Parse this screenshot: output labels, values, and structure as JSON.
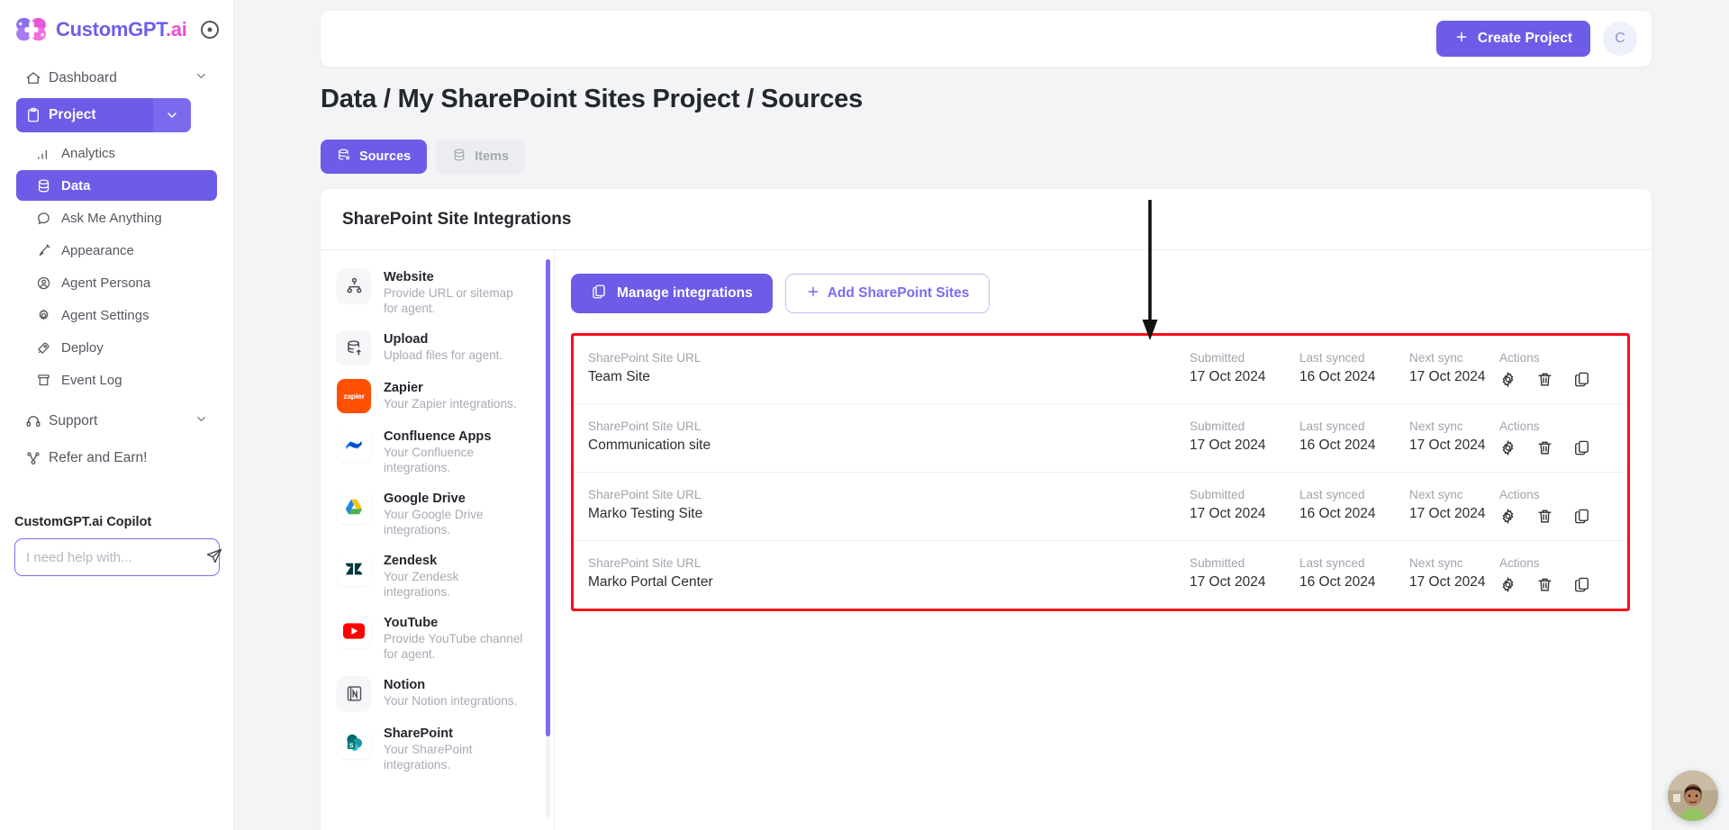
{
  "brand": {
    "name_part1": "CustomGPT",
    "name_part2": ".ai",
    "help_icon": "help-circle-icon"
  },
  "sidebar": {
    "nav": [
      {
        "label": "Dashboard",
        "icon": "home-icon",
        "chevron": "chevron-down-icon"
      },
      {
        "label": "Project",
        "icon": "clipboard-icon",
        "chevron": "chevron-down-icon"
      }
    ],
    "subnav": [
      {
        "label": "Analytics",
        "icon": "bar-chart-icon"
      },
      {
        "label": "Data",
        "icon": "database-icon"
      },
      {
        "label": "Ask Me Anything",
        "icon": "chat-bubble-icon"
      },
      {
        "label": "Appearance",
        "icon": "brush-icon"
      },
      {
        "label": "Agent Persona",
        "icon": "user-circle-icon"
      },
      {
        "label": "Agent Settings",
        "icon": "gear-icon"
      },
      {
        "label": "Deploy",
        "icon": "rocket-icon"
      },
      {
        "label": "Event Log",
        "icon": "archive-icon"
      }
    ],
    "support": {
      "label": "Support",
      "icon": "headset-icon",
      "chevron": "chevron-down-icon"
    },
    "refer": {
      "label": "Refer and Earn!",
      "icon": "share-nodes-icon"
    },
    "copilot": {
      "title": "CustomGPT.ai Copilot",
      "placeholder": "I need help with...",
      "value": "",
      "send_icon": "send-icon"
    }
  },
  "topbar": {
    "create_label": "Create Project",
    "plus_icon": "plus-icon",
    "avatar_initial": "C"
  },
  "page": {
    "title": "Data / My SharePoint Sites Project / Sources",
    "tabs": [
      {
        "label": "Sources",
        "icon": "database-gear-icon",
        "selected": true
      },
      {
        "label": "Items",
        "icon": "database-icon",
        "selected": false
      }
    ]
  },
  "card": {
    "heading": "SharePoint Site Integrations",
    "integrations": [
      {
        "name": "Website",
        "desc": "Provide URL or sitemap for agent.",
        "icon": "sitemap-icon"
      },
      {
        "name": "Upload",
        "desc": "Upload files for agent.",
        "icon": "database-upload-icon"
      },
      {
        "name": "Zapier",
        "desc": "Your Zapier integrations.",
        "icon": "zapier-icon"
      },
      {
        "name": "Confluence Apps",
        "desc": "Your Confluence integrations.",
        "icon": "confluence-icon"
      },
      {
        "name": "Google Drive",
        "desc": "Your Google Drive integrations.",
        "icon": "google-drive-icon"
      },
      {
        "name": "Zendesk",
        "desc": "Your Zendesk integrations.",
        "icon": "zendesk-icon"
      },
      {
        "name": "YouTube",
        "desc": "Provide YouTube channel for agent.",
        "icon": "youtube-icon"
      },
      {
        "name": "Notion",
        "desc": "Your Notion integrations.",
        "icon": "notion-icon"
      },
      {
        "name": "SharePoint",
        "desc": "Your SharePoint integrations.",
        "icon": "sharepoint-icon"
      }
    ],
    "buttons": {
      "manage": {
        "label": "Manage integrations",
        "icon": "copy-icon"
      },
      "add": {
        "label": "Add SharePoint Sites",
        "icon": "plus-icon"
      }
    },
    "table": {
      "labels": {
        "url": "SharePoint Site URL",
        "submitted": "Submitted",
        "last_synced": "Last synced",
        "next_sync": "Next sync",
        "actions": "Actions"
      },
      "action_icons": [
        "gear-icon",
        "trash-icon",
        "copy-icon"
      ],
      "rows": [
        {
          "url": "Team Site",
          "submitted": "17 Oct 2024",
          "last_synced": "16 Oct 2024",
          "next_sync": "17 Oct 2024"
        },
        {
          "url": "Communication site",
          "submitted": "17 Oct 2024",
          "last_synced": "16 Oct 2024",
          "next_sync": "17 Oct 2024"
        },
        {
          "url": "Marko Testing Site",
          "submitted": "17 Oct 2024",
          "last_synced": "16 Oct 2024",
          "next_sync": "17 Oct 2024"
        },
        {
          "url": "Marko Portal Center",
          "submitted": "17 Oct 2024",
          "last_synced": "16 Oct 2024",
          "next_sync": "17 Oct 2024"
        }
      ]
    }
  },
  "annotations": {
    "arrow": {
      "icon": "down-arrow-annotation",
      "color": "#000000"
    },
    "highlight_box_color": "#fc0d1b"
  },
  "chat_widget": {
    "icon": "support-agent-avatar"
  }
}
